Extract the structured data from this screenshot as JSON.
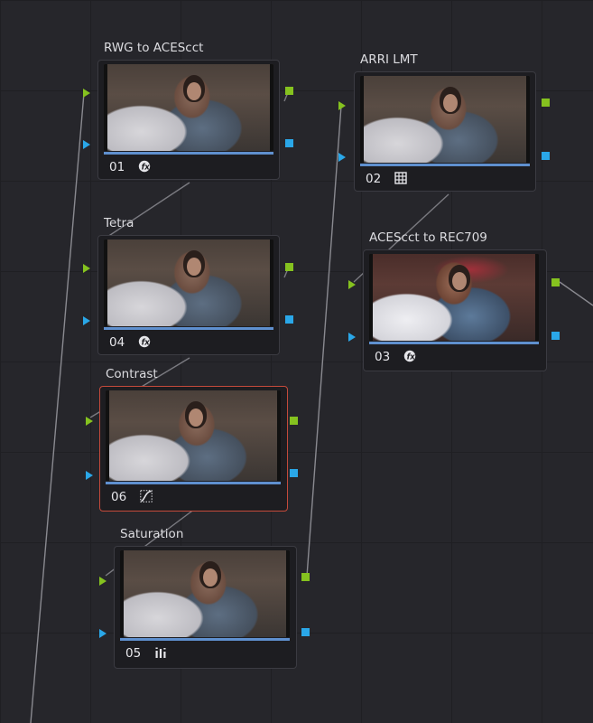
{
  "nodes": [
    {
      "label": "RWG to ACEScct",
      "number": "01",
      "icon": "fx-icon"
    },
    {
      "label": "Tetra",
      "number": "04",
      "icon": "fx-icon"
    },
    {
      "label": "Contrast",
      "number": "06",
      "icon": "curves-icon",
      "selected": true
    },
    {
      "label": "Saturation",
      "number": "05",
      "icon": "levels-icon"
    },
    {
      "label": "ARRI LMT",
      "number": "02",
      "icon": "lut-grid-icon"
    },
    {
      "label": "ACEScct to REC709",
      "number": "03",
      "icon": "fx-icon"
    }
  ],
  "colors": {
    "background": "#26262b",
    "rgb_port": "#85c21f",
    "alpha_port": "#2aa7e8",
    "selection": "#c44a3b",
    "divider": "#5f90cf"
  }
}
